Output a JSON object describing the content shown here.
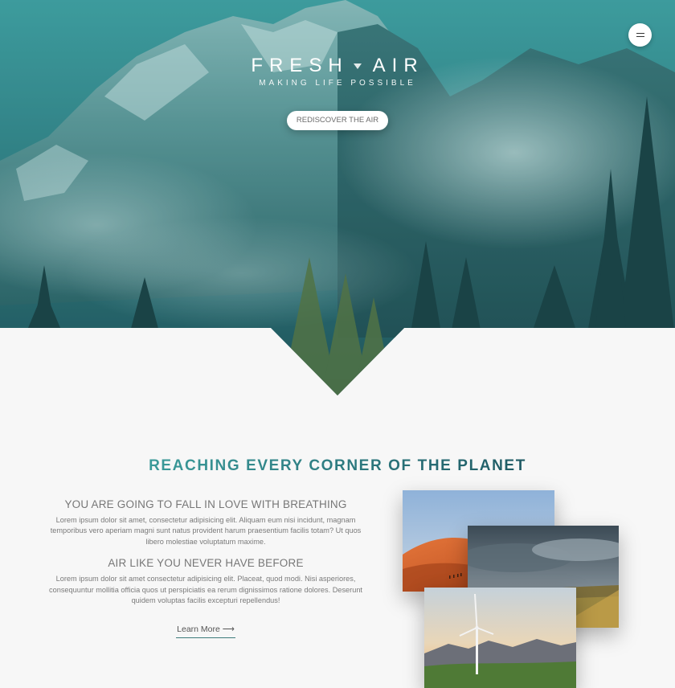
{
  "hero": {
    "brand_left": "FRESH",
    "brand_right": "AIR",
    "tagline": "MAKING LIFE POSSIBLE",
    "cta_label": "REDISCOVER THE AIR",
    "menu_icon": "hamburger-icon",
    "background": "misty-mountain-forest-photo"
  },
  "section": {
    "title": "REACHING EVERY CORNER OF THE PLANET",
    "blocks": [
      {
        "heading": "YOU ARE GOING TO FALL IN LOVE WITH BREATHING",
        "body": "Lorem ipsum dolor sit amet, consectetur adipisicing elit. Aliquam eum nisi incidunt, magnam temporibus vero aperiam magni sunt natus provident harum praesentium facilis totam? Ut quos libero molestiae voluptatum maxime."
      },
      {
        "heading": "AIR LIKE YOU NEVER HAVE BEFORE",
        "body": "Lorem ipsum dolor sit amet consectetur adipisicing elit. Placeat, quod modi. Nisi asperiores, consequuntur mollitia officia quos ut perspiciatis ea rerum dignissimos ratione dolores. Deserunt quidem voluptas facilis excepturi repellendus!"
      }
    ],
    "link_label": "Learn More ⟶",
    "photos": [
      "desert-dunes-photo",
      "grassland-clouds-photo",
      "wind-turbine-photo"
    ]
  },
  "colors": {
    "accent": "#2b8b8c",
    "accent_dark": "#1f5a64",
    "page_bg": "#f7f7f7"
  }
}
